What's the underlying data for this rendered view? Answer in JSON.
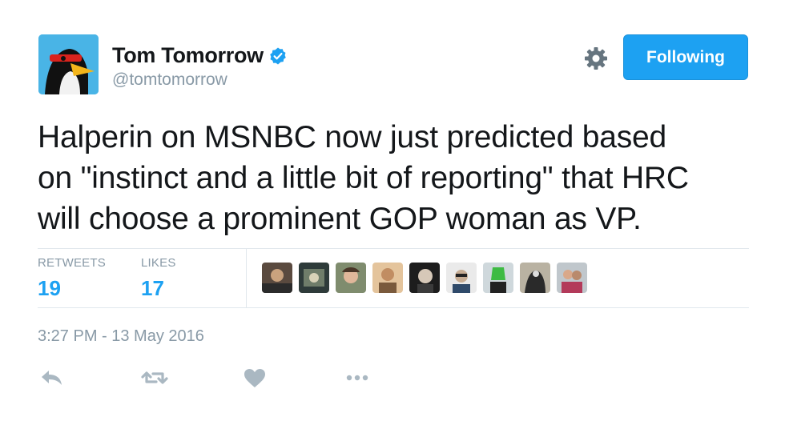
{
  "user": {
    "display_name": "Tom Tomorrow",
    "handle": "@tomtomorrow",
    "verified_icon": "verified-badge-icon",
    "avatar_icon": "penguin-avatar"
  },
  "header": {
    "follow_label": "Following",
    "gear_icon": "gear-icon"
  },
  "tweet": {
    "text": "Halperin on MSNBC now just predicted based\non \"instinct and a little bit of reporting\" that HRC\nwill choose a prominent GOP woman as VP.",
    "timestamp": "3:27 PM - 13 May 2016"
  },
  "stats": {
    "retweets_label": "RETWEETS",
    "retweets_value": "19",
    "likes_label": "LIKES",
    "likes_value": "17"
  },
  "actions": [
    "reply-icon",
    "retweet-icon",
    "like-icon",
    "more-icon"
  ],
  "colors": {
    "accent": "#1da1f2",
    "muted": "#8899a6",
    "text": "#14171a",
    "divider": "#e1e8ed",
    "action_icon": "#aab8c2"
  }
}
